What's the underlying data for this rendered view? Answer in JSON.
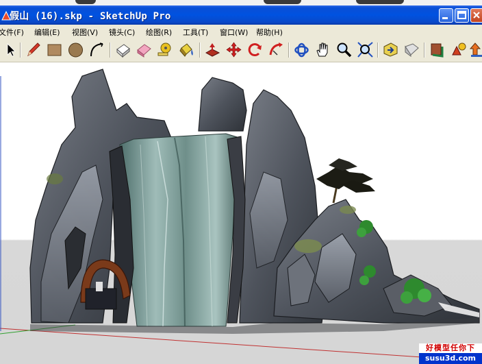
{
  "window": {
    "title": "假山 (16).skp - SketchUp Pro",
    "title_bar_color": "#0052e0"
  },
  "menu": {
    "items": [
      {
        "label": "文件(F)"
      },
      {
        "label": "编辑(E)"
      },
      {
        "label": "视图(V)"
      },
      {
        "label": "镜头(C)"
      },
      {
        "label": "绘图(R)"
      },
      {
        "label": "工具(T)"
      },
      {
        "label": "窗口(W)"
      },
      {
        "label": "帮助(H)"
      }
    ]
  },
  "toolbar": {
    "tools": [
      "select-icon",
      "pencil-icon",
      "rectangle-icon",
      "circle-icon",
      "arc-icon",
      "eraser-clear-icon",
      "eraser-icon",
      "tape-measure-icon",
      "paint-bucket-icon",
      "push-pull-icon",
      "move-icon",
      "rotate-icon",
      "follow-me-icon",
      "orbit-icon",
      "pan-icon",
      "zoom-icon",
      "zoom-extents-icon",
      "warehouse-icon",
      "component-icon",
      "section-icon",
      "components-icon",
      "upload-icon"
    ]
  },
  "watermark": {
    "line1": "好模型任你下",
    "line2": "susu3d.com",
    "line1_color": "#d00000",
    "line2_bg": "#0033cc"
  },
  "colors": {
    "ui_face": "#ece9d8",
    "sky": "#ffffff",
    "ground": "#d6d6d6"
  }
}
